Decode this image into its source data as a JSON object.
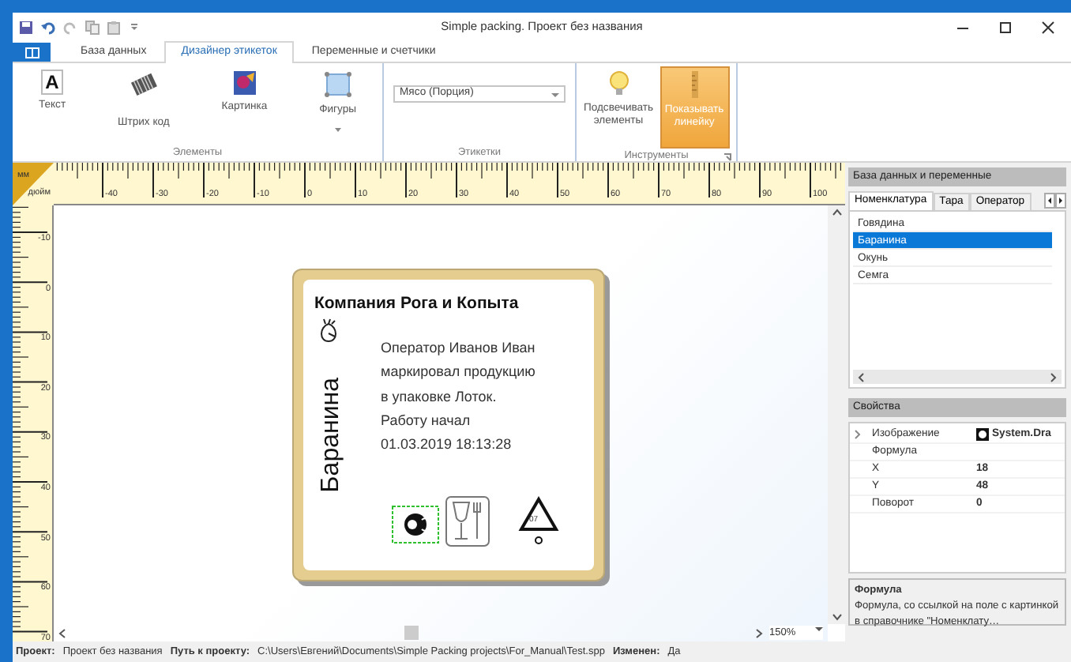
{
  "window": {
    "title": "Simple packing. Проект без названия"
  },
  "ribbon": {
    "tabs": [
      {
        "label": "База данных",
        "selected": false
      },
      {
        "label": "Дизайнер этикеток",
        "selected": true
      },
      {
        "label": "Переменные и счетчики",
        "selected": false
      }
    ],
    "groups": [
      {
        "title": "Элементы",
        "kind": "buttons",
        "buttons": [
          {
            "label": "Текст",
            "glyph": "A",
            "dropdown": false
          },
          {
            "label": "Штрих код",
            "dropdown": false
          },
          {
            "label": "Картинка",
            "dropdown": false
          },
          {
            "label": "Фигуры",
            "dropdown": true
          }
        ]
      },
      {
        "title": "Этикетки",
        "kind": "combo",
        "value": "Мясо (Порция)"
      },
      {
        "title": "Инструменты",
        "kind": "toggles",
        "buttons": [
          {
            "label": "Подсвечивать элементы",
            "selected": false
          },
          {
            "label": "Показывать линейку",
            "selected": true
          }
        ]
      }
    ]
  },
  "ruler": {
    "corner_top": "мм",
    "corner_bottom": "дюйм",
    "horizontal": [
      "-40",
      "-30",
      "-20",
      "-10",
      "0",
      "10",
      "20",
      "30",
      "40",
      "50",
      "60",
      "70",
      "80",
      "90",
      "100"
    ],
    "vertical": [
      "-10",
      "0",
      "10",
      "20",
      "30",
      "40",
      "50",
      "60",
      "70"
    ]
  },
  "label": {
    "company": "Компания Рога и Копыта",
    "product": "Баранина",
    "recycling_code": "07",
    "text_lines": [
      "Оператор Иванов Иван",
      "маркировал продукцию",
      "в упаковке Лоток.",
      "Работу начал",
      "01.03.2019 18:13:28"
    ]
  },
  "zoom": "150%",
  "database_panel": {
    "title": "База данных и переменные",
    "tabs": [
      {
        "label": "Номенклатура",
        "selected": true
      },
      {
        "label": "Тара",
        "selected": false
      },
      {
        "label": "Оператор",
        "selected": false
      }
    ],
    "items": [
      {
        "label": "Говядина",
        "selected": false
      },
      {
        "label": "Баранина",
        "selected": true
      },
      {
        "label": "Окунь",
        "selected": false
      },
      {
        "label": "Семга",
        "selected": false
      }
    ]
  },
  "properties_panel": {
    "title": "Свойства",
    "rows": [
      {
        "name": "Изображение",
        "value": "System.Dra",
        "expandable": true
      },
      {
        "name": "Формула",
        "expandable": false
      },
      {
        "name": "X",
        "value": "18",
        "expandable": false
      },
      {
        "name": "Y",
        "value": "48",
        "expandable": false
      },
      {
        "name": "Поворот",
        "value": "0",
        "expandable": false
      }
    ]
  },
  "help": {
    "title": "Формула",
    "text": "Формула, со ссылкой на поле с картинкой в справочнике \"Номенклату…"
  },
  "status_bar": [
    {
      "label": "Проект:",
      "value": "Проект без названия"
    },
    {
      "label": "Путь к проекту:",
      "value": "C:\\Users\\Евгений\\Documents\\Simple Packing projects\\For_Manual\\Test.spp"
    },
    {
      "label": "Изменен:",
      "value": "Да"
    }
  ]
}
